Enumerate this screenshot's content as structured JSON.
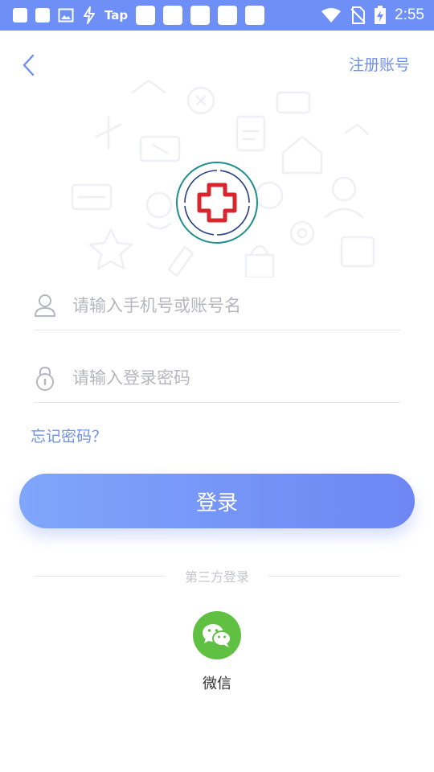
{
  "status_bar": {
    "tap_label": "Tap",
    "time": "2:55"
  },
  "header": {
    "register_label": "注册账号",
    "back_icon": "chevron-left-icon"
  },
  "logo": {
    "icon": "medical-cross-icon",
    "accent": "#d9262c"
  },
  "form": {
    "account_placeholder": "请输入手机号或账号名",
    "account_value": "",
    "password_placeholder": "请输入登录密码",
    "password_value": "",
    "forgot_label": "忘记密码？",
    "login_label": "登录"
  },
  "third_party": {
    "title": "第三方登录",
    "options": [
      {
        "label": "微信",
        "icon": "wechat-icon",
        "color": "#5fc042"
      }
    ]
  },
  "colors": {
    "accent": "#6d8ff6",
    "status_bar": "#6d8ff6"
  }
}
